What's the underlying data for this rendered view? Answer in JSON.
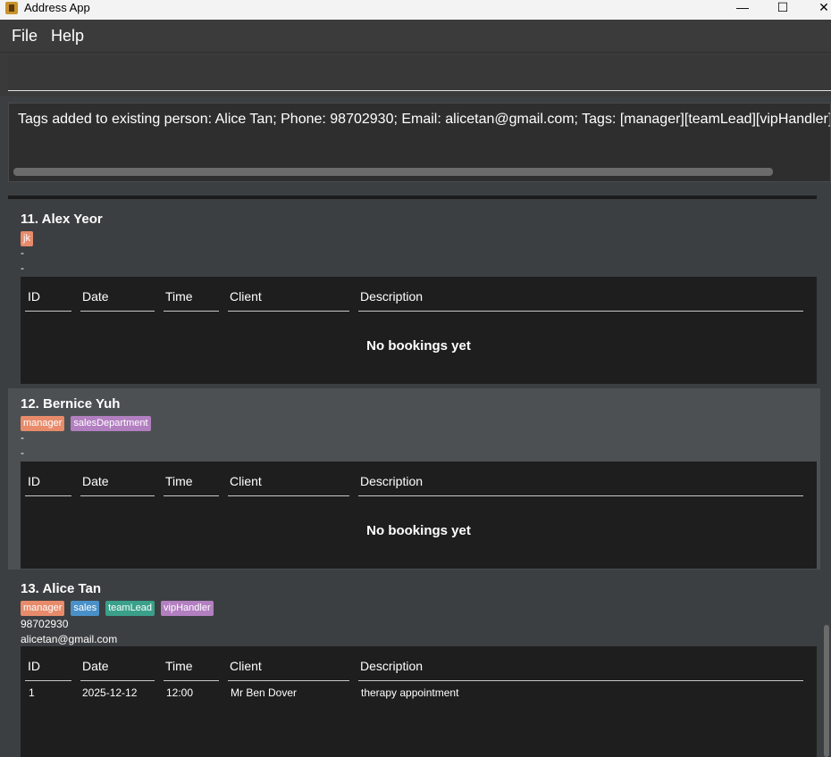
{
  "window": {
    "title": "Address App",
    "icon": "app-icon"
  },
  "controls": {
    "minimize": "—",
    "maximize": "☐",
    "close": "✕"
  },
  "menu": {
    "file": "File",
    "help": "Help"
  },
  "command": {
    "value": ""
  },
  "result": {
    "text": "Tags added to existing person: Alice Tan; Phone: 98702930; Email: alicetan@gmail.com; Tags: [manager][teamLead][vipHandler]"
  },
  "tag_colors": {
    "jk": "#e78b6b",
    "manager": "#e78b6b",
    "salesDepartment": "#b27fc0",
    "sales": "#4a90c8",
    "teamLead": "#3aa08a",
    "vipHandler": "#b27fc0"
  },
  "columns": [
    "ID",
    "Date",
    "Time",
    "Client",
    "Description"
  ],
  "persons": [
    {
      "name": "11. Alex Yeor",
      "tags": [
        "jk"
      ],
      "phone": "-",
      "email": "-",
      "bookings_empty": "No bookings yet",
      "bookings": []
    },
    {
      "name": "12. Bernice Yuh",
      "tags": [
        "manager",
        "salesDepartment"
      ],
      "phone": "-",
      "email": "-",
      "bookings_empty": "No bookings yet",
      "bookings": []
    },
    {
      "name": "13. Alice Tan",
      "tags": [
        "manager",
        "sales",
        "teamLead",
        "vipHandler"
      ],
      "phone": "98702930",
      "email": "alicetan@gmail.com",
      "bookings_empty": "",
      "bookings": [
        {
          "id": "1",
          "date": "2025-12-12",
          "time": "12:00",
          "client": "Mr Ben Dover",
          "description": "therapy appointment"
        }
      ]
    }
  ]
}
